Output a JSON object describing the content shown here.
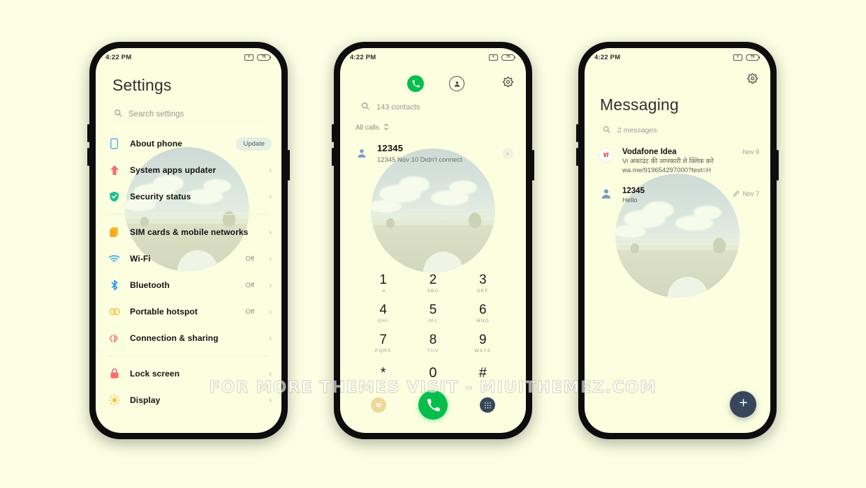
{
  "watermark": "FOR MORE THEMES VISIT - MIUITHEMEZ.COM",
  "statusbar": {
    "time": "4:22 PM",
    "battery_level": "70",
    "vibrate_icon": "vibrate-icon",
    "battery_icon": "battery-icon"
  },
  "settings": {
    "title": "Settings",
    "search_placeholder": "Search settings",
    "search_icon": "search-icon",
    "groups": [
      {
        "items": [
          {
            "label": "About phone",
            "icon": "phone-outline-icon",
            "badge": "Update",
            "value": "",
            "chevron": false
          },
          {
            "label": "System apps updater",
            "icon": "up-arrow-icon",
            "badge": "",
            "value": "",
            "chevron": true
          },
          {
            "label": "Security status",
            "icon": "shield-check-icon",
            "badge": "",
            "value": "",
            "chevron": true
          }
        ]
      },
      {
        "items": [
          {
            "label": "SIM cards & mobile networks",
            "icon": "sim-card-icon",
            "badge": "",
            "value": "",
            "chevron": true
          },
          {
            "label": "Wi-Fi",
            "icon": "wifi-icon",
            "badge": "",
            "value": "Off",
            "chevron": true
          },
          {
            "label": "Bluetooth",
            "icon": "bluetooth-icon",
            "badge": "",
            "value": "Off",
            "chevron": true
          },
          {
            "label": "Portable hotspot",
            "icon": "hotspot-icon",
            "badge": "",
            "value": "Off",
            "chevron": true
          },
          {
            "label": "Connection & sharing",
            "icon": "connection-sharing-icon",
            "badge": "",
            "value": "",
            "chevron": true
          }
        ]
      },
      {
        "items": [
          {
            "label": "Lock screen",
            "icon": "lock-icon",
            "badge": "",
            "value": "",
            "chevron": true
          },
          {
            "label": "Display",
            "icon": "brightness-icon",
            "badge": "",
            "value": "",
            "chevron": true
          }
        ]
      }
    ]
  },
  "dialer": {
    "tab_call_icon": "phone-handset-icon",
    "tab_contacts_icon": "contacts-person-icon",
    "settings_icon": "gear-icon",
    "search_icon": "search-icon",
    "search_placeholder": "143 contacts",
    "filter_label": "All calls",
    "filter_icon": "sort-updown-icon",
    "call_log": [
      {
        "number": "12345",
        "subtitle": "12345  Nov 10 Didn't connect",
        "avatar_icon": "person-avatar-icon",
        "detail_icon": "chevron-right-icon"
      }
    ],
    "keys": [
      {
        "num": "1",
        "letters": "",
        "voicemail": "∞"
      },
      {
        "num": "2",
        "letters": "ABC",
        "voicemail": ""
      },
      {
        "num": "3",
        "letters": "DEF",
        "voicemail": ""
      },
      {
        "num": "4",
        "letters": "GHI",
        "voicemail": ""
      },
      {
        "num": "5",
        "letters": "JKL",
        "voicemail": ""
      },
      {
        "num": "6",
        "letters": "MNO",
        "voicemail": ""
      },
      {
        "num": "7",
        "letters": "PQRS",
        "voicemail": ""
      },
      {
        "num": "8",
        "letters": "TUV",
        "voicemail": ""
      },
      {
        "num": "9",
        "letters": "WXYZ",
        "voicemail": ""
      },
      {
        "num": "*",
        "letters": "",
        "voicemail": ""
      },
      {
        "num": "0",
        "letters": "",
        "voicemail": ""
      },
      {
        "num": "#",
        "letters": "",
        "voicemail": ""
      }
    ],
    "bottom": {
      "menu_icon": "menu-lines-icon",
      "call_icon": "phone-handset-icon",
      "keypad_icon": "dialpad-icon"
    },
    "colors": {
      "call_green": "#06BE4B",
      "menu_yellow": "#EFD89A",
      "keypad_navy": "#37465A"
    }
  },
  "messaging": {
    "title": "Messaging",
    "settings_icon": "gear-icon",
    "search_icon": "search-icon",
    "search_placeholder": "2 messages",
    "threads": [
      {
        "name": "Vodafone Idea",
        "preview": "Vi अकाउंट की जानकारी ले क्लिक करे wa.me/919654297000?text=H",
        "date": "Nov 9",
        "avatar": "VI",
        "avatar_icon": "vodafone-logo-icon",
        "draft": false
      },
      {
        "name": "12345",
        "preview": "Hello",
        "date": "Nov 7",
        "avatar": "",
        "avatar_icon": "person-avatar-icon",
        "draft": true,
        "draft_icon": "pencil-icon"
      }
    ],
    "fab_icon": "plus-icon",
    "fab_color": "#37465A"
  }
}
